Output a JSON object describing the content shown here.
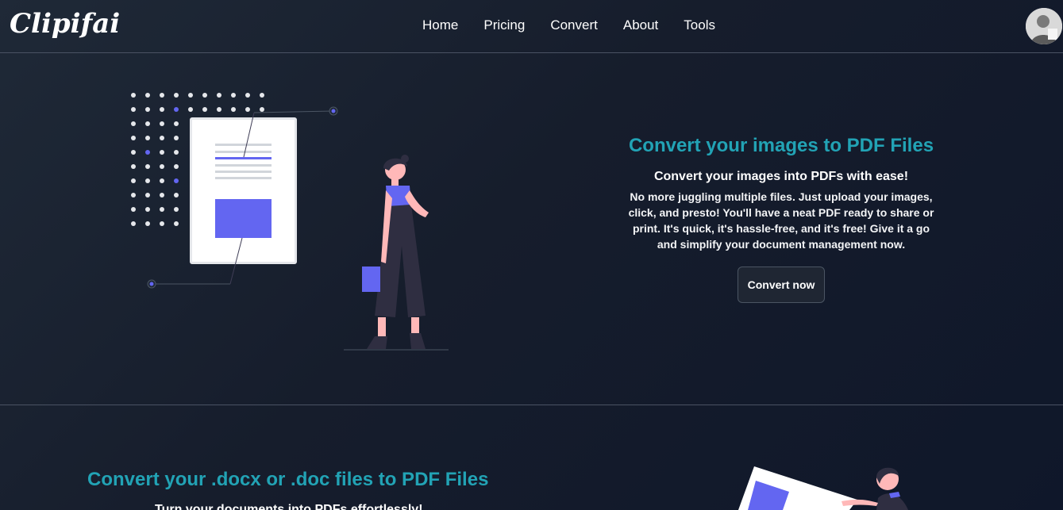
{
  "brand": {
    "logo": "Clipifai"
  },
  "nav": {
    "links": [
      "Home",
      "Pricing",
      "Convert",
      "About",
      "Tools"
    ]
  },
  "hero": {
    "title": "Convert your images to PDF Files",
    "subtitle": "Convert your images into PDFs with ease!",
    "description": "No more juggling multiple files. Just upload your images, click, and presto! You'll have a neat PDF ready to share or print. It's quick, it's hassle-free, and it's free! Give it a go and simplify your document management now.",
    "cta_label": "Convert now"
  },
  "section2": {
    "title": "Convert your .docx or .doc files to PDF Files",
    "subtitle": "Turn your documents into PDFs effortlessly!"
  },
  "colors": {
    "accent": "#22a3b5",
    "illustration_purple": "#6366f1",
    "background": "#1f2937"
  }
}
